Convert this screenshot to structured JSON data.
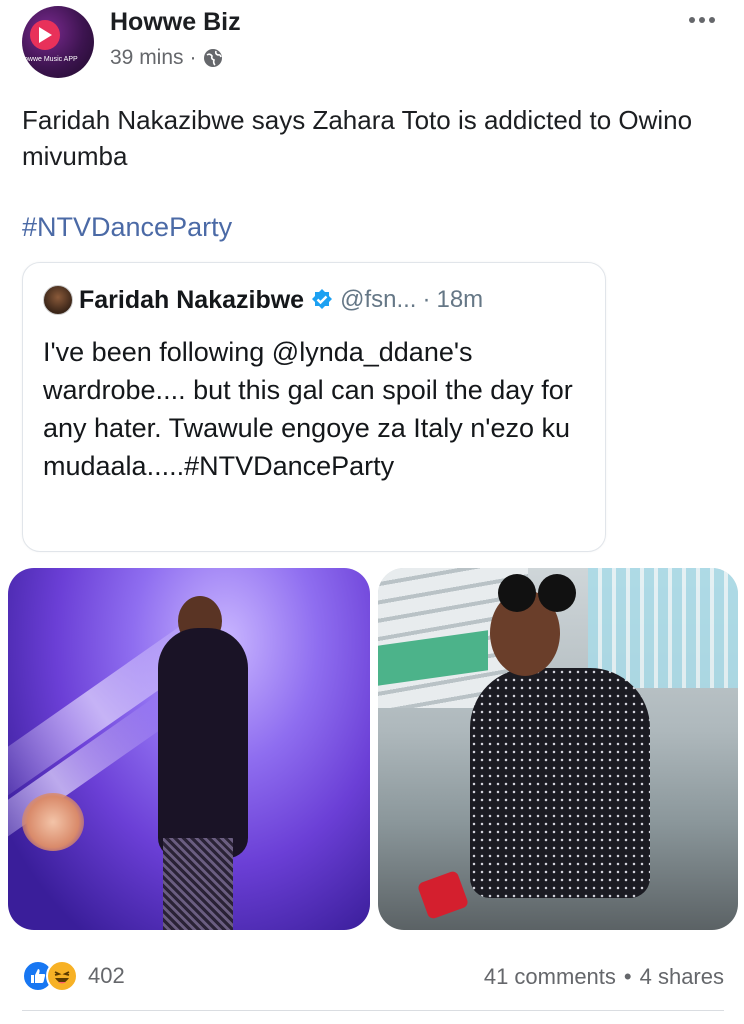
{
  "post": {
    "page_name": "Howwe Biz",
    "time": "39 mins",
    "meta_separator": "·",
    "avatar_text": "owwe Music APP",
    "avatar_icon": "play-icon",
    "privacy_icon": "globe-icon",
    "more_icon": "more-options-icon",
    "text": "Faridah Nakazibwe says Zahara Toto is addicted to Owino mivumba",
    "hashtag": "#NTVDanceParty"
  },
  "tweet": {
    "name": "Faridah Nakazibwe",
    "verified_icon": "verified-badge-icon",
    "handle": "@fsn...",
    "separator": "·",
    "time": "18m",
    "body": "I've been following @lynda_ddane's wardrobe.... but this gal can spoil the day for any hater. Twawule engoye za Italy n'ezo ku mudaala.....#NTVDanceParty"
  },
  "footer": {
    "reaction_icons": [
      "like-icon",
      "haha-icon"
    ],
    "reaction_count": "402",
    "comments": "41 comments",
    "dot": "•",
    "shares": "4 shares"
  },
  "colors": {
    "hashtag": "#4b6aa6",
    "secondary_text": "#65676b",
    "like_blue": "#1877f2",
    "verified_blue": "#1da1f2"
  }
}
